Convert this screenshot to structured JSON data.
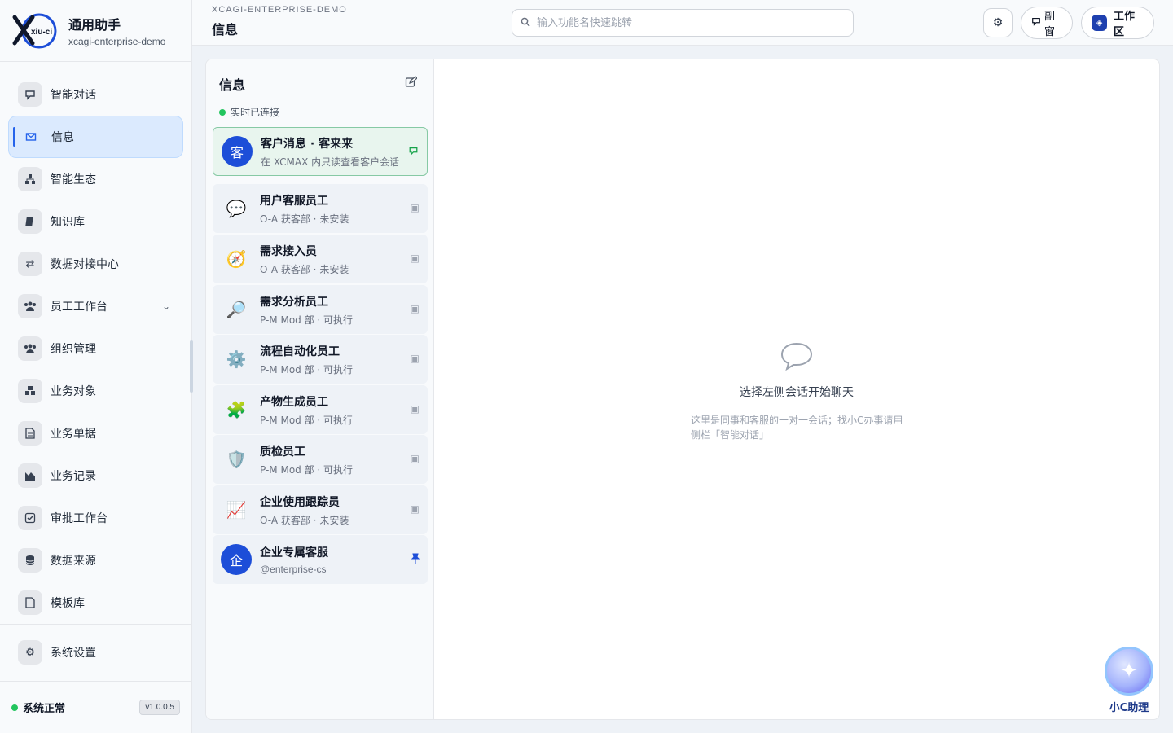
{
  "brand": {
    "logo_text": "xiu-ci",
    "title": "通用助手",
    "subtitle": "xcagi-enterprise-demo"
  },
  "sidebar": {
    "items": [
      {
        "label": "智能对话",
        "icon": "chat-icon"
      },
      {
        "label": "信息",
        "icon": "mail-icon",
        "active": true
      },
      {
        "label": "智能生态",
        "icon": "hierarchy-icon"
      },
      {
        "label": "知识库",
        "icon": "book-icon"
      },
      {
        "label": "数据对接中心",
        "icon": "exchange-icon"
      },
      {
        "label": "员工工作台",
        "icon": "users-icon",
        "has_children": true
      },
      {
        "label": "组织管理",
        "icon": "users-icon"
      },
      {
        "label": "业务对象",
        "icon": "cubes-icon"
      },
      {
        "label": "业务单据",
        "icon": "document-icon"
      },
      {
        "label": "业务记录",
        "icon": "chart-icon"
      },
      {
        "label": "审批工作台",
        "icon": "check-square-icon"
      },
      {
        "label": "数据来源",
        "icon": "database-icon"
      },
      {
        "label": "模板库",
        "icon": "file-icon"
      }
    ],
    "settings_label": "系统设置",
    "status_text": "系统正常",
    "version": "v1.0.0.5"
  },
  "topbar": {
    "breadcrumb": "XCAGI-ENTERPRISE-DEMO",
    "title": "信息",
    "search_placeholder": "输入功能名快速跳转",
    "float_window_label": "副窗",
    "workspace_label": "工作区"
  },
  "messages": {
    "title": "信息",
    "connection_status": "实时已连接",
    "conversations": [
      {
        "name": "客户消息 · 客来来",
        "sub": "在 XCMAX 内只读查看客户会话",
        "avatar_text": "客",
        "avatar_type": "blue",
        "tail": "chat-icon"
      },
      {
        "name": "用户客服员工",
        "sub": "O-A 获客部 · 未安装",
        "avatar_text": "💬",
        "avatar_type": "emoji",
        "tail": "lock-icon"
      },
      {
        "name": "需求接入员",
        "sub": "O-A 获客部 · 未安装",
        "avatar_text": "🧭",
        "avatar_type": "emoji",
        "tail": "lock-icon"
      },
      {
        "name": "需求分析员工",
        "sub": "P-M Mod 部 · 可执行",
        "avatar_text": "🔎",
        "avatar_type": "emoji",
        "tail": "lock-icon"
      },
      {
        "name": "流程自动化员工",
        "sub": "P-M Mod 部 · 可执行",
        "avatar_text": "⚙️",
        "avatar_type": "emoji",
        "tail": "lock-icon"
      },
      {
        "name": "产物生成员工",
        "sub": "P-M Mod 部 · 可执行",
        "avatar_text": "🧩",
        "avatar_type": "emoji",
        "tail": "lock-icon"
      },
      {
        "name": "质检员工",
        "sub": "P-M Mod 部 · 可执行",
        "avatar_text": "🛡️",
        "avatar_type": "emoji",
        "tail": "lock-icon"
      },
      {
        "name": "企业使用跟踪员",
        "sub": "O-A 获客部 · 未安装",
        "avatar_text": "📈",
        "avatar_type": "emoji",
        "tail": "lock-icon"
      },
      {
        "name": "企业专属客服",
        "sub": "@enterprise-cs",
        "avatar_text": "企",
        "avatar_type": "blue",
        "tail": "pin-icon"
      }
    ]
  },
  "empty_state": {
    "title": "选择左侧会话开始聊天",
    "description": "这里是同事和客服的一对一会话；找小C办事请用侧栏「智能对话」"
  },
  "assistant": {
    "label": "小C助理"
  },
  "colors": {
    "accent": "#2563eb",
    "online": "#22c55e",
    "active_bg": "#dbeafe"
  }
}
